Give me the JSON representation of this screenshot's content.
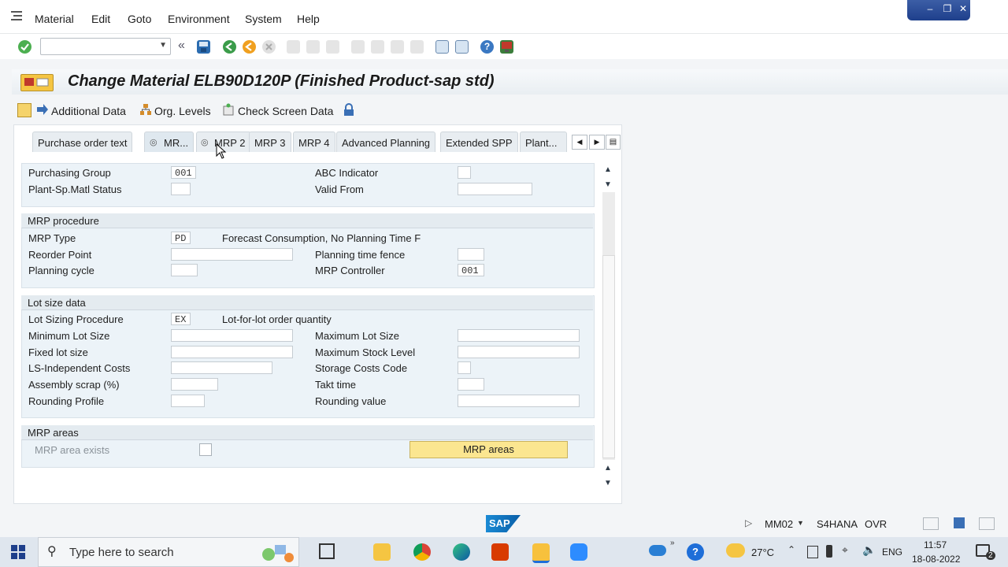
{
  "menu": {
    "items": [
      "Material",
      "Edit",
      "Goto",
      "Environment",
      "System",
      "Help"
    ]
  },
  "toolbar": {
    "command_value": "",
    "icons": [
      "enter-icon",
      "back-double-icon",
      "save-icon",
      "back-icon",
      "exit-icon",
      "cancel-icon",
      "print-icon",
      "find-icon",
      "find-next-icon",
      "first-page-icon",
      "prev-page-icon",
      "next-page-icon",
      "last-page-icon",
      "create-session-icon",
      "shortcut-icon",
      "help-icon",
      "customize-layout-icon"
    ]
  },
  "title": "Change Material ELB90D120P (Finished Product-sap std)",
  "app_toolbar": {
    "additional_data": "Additional Data",
    "org_levels": "Org. Levels",
    "check_screen_data": "Check Screen Data"
  },
  "tabs": [
    {
      "label": "Purchase order text",
      "active": false
    },
    {
      "label": "MR...",
      "active": true
    },
    {
      "label": "MRP 2",
      "active": false
    },
    {
      "label": "MRP 3",
      "active": false
    },
    {
      "label": "MRP 4",
      "active": false
    },
    {
      "label": "Advanced Planning",
      "active": false
    },
    {
      "label": "Extended SPP",
      "active": false
    },
    {
      "label": "Plant...",
      "active": false
    }
  ],
  "general": {
    "purchasing_group_label": "Purchasing Group",
    "purchasing_group_value": "001",
    "plant_sp_matl_status_label": "Plant-Sp.Matl Status",
    "plant_sp_matl_status_value": "",
    "abc_indicator_label": "ABC Indicator",
    "abc_indicator_value": "",
    "valid_from_label": "Valid From",
    "valid_from_value": ""
  },
  "mrp_procedure": {
    "title": "MRP procedure",
    "mrp_type_label": "MRP Type",
    "mrp_type_value": "PD",
    "mrp_type_desc": "Forecast Consumption, No Planning Time F",
    "reorder_point_label": "Reorder Point",
    "reorder_point_value": "",
    "planning_time_fence_label": "Planning time fence",
    "planning_time_fence_value": "",
    "planning_cycle_label": "Planning cycle",
    "planning_cycle_value": "",
    "mrp_controller_label": "MRP Controller",
    "mrp_controller_value": "001"
  },
  "lot_size": {
    "title": "Lot size data",
    "lot_sizing_procedure_label": "Lot Sizing Procedure",
    "lot_sizing_procedure_value": "EX",
    "lot_sizing_procedure_desc": "Lot-for-lot order quantity",
    "min_lot_size_label": "Minimum Lot Size",
    "max_lot_size_label": "Maximum Lot Size",
    "fixed_lot_size_label": "Fixed lot size",
    "max_stock_level_label": "Maximum Stock Level",
    "ls_independent_costs_label": "LS-Independent Costs",
    "storage_costs_code_label": "Storage Costs Code",
    "assembly_scrap_label": "Assembly scrap (%)",
    "takt_time_label": "Takt time",
    "rounding_profile_label": "Rounding Profile",
    "rounding_value_label": "Rounding value"
  },
  "mrp_areas": {
    "title": "MRP areas",
    "exists_label": "MRP area exists",
    "button_label": "MRP areas"
  },
  "status_bar": {
    "transaction": "MM02",
    "system": "S4HANA",
    "mode": "OVR"
  },
  "taskbar": {
    "search_placeholder": "Type here to search",
    "temperature": "27°C",
    "language": "ENG",
    "time": "11:57",
    "date": "18-08-2022",
    "notification_count": "2"
  },
  "colors": {
    "accent_blue": "#1e3f8b",
    "mrp_button": "#fbe690",
    "section_bg": "#ecf3f8"
  }
}
